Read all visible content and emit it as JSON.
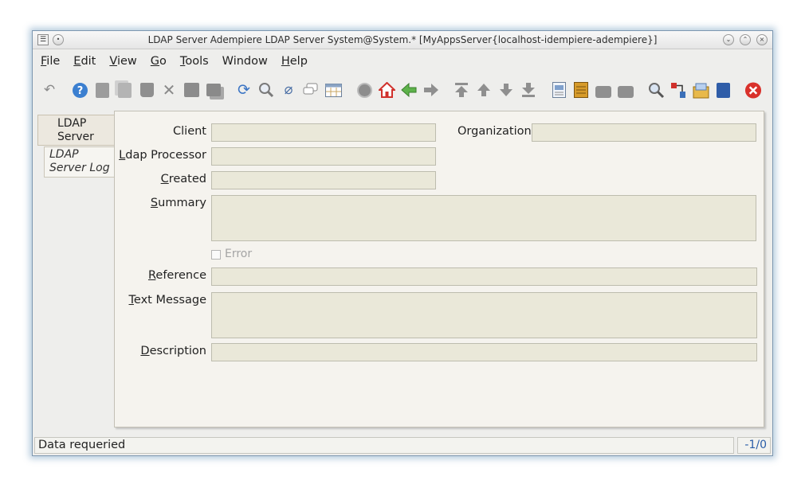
{
  "window": {
    "title": "LDAP Server  Adempiere LDAP Server  System@System.* [MyAppsServer{localhost-idempiere-adempiere}]"
  },
  "menu": {
    "file": "File",
    "edit": "Edit",
    "view": "View",
    "go": "Go",
    "tools": "Tools",
    "window": "Window",
    "help": "Help"
  },
  "toolbar": {
    "icons": [
      "undo-icon",
      "help-icon",
      "new-icon",
      "copy-icon",
      "delete-icon",
      "delete-selection-icon",
      "save-icon",
      "save-new-icon",
      "refresh-icon",
      "find-icon",
      "attachment-icon",
      "chat-icon",
      "grid-toggle-icon",
      "history-icon",
      "home-icon",
      "parent-icon",
      "detail-icon",
      "first-record-icon",
      "previous-record-icon",
      "next-record-icon",
      "last-record-icon",
      "report-icon",
      "archive-icon",
      "print-preview-icon",
      "print-icon",
      "zoom-across-icon",
      "workflow-icon",
      "product-info-icon",
      "end-icon",
      "close-window-icon"
    ]
  },
  "tabs": [
    {
      "label_line1": "LDAP",
      "label_line2": "Server"
    },
    {
      "label_line1": "LDAP",
      "label_line2": "Server Log"
    }
  ],
  "form": {
    "client_label": "Client",
    "client_value": "",
    "organization_label": "Organization",
    "organization_value": "",
    "ldap_processor_label_pre": "",
    "ldap_processor_label_u": "L",
    "ldap_processor_label_post": "dap Processor",
    "ldap_processor_value": "",
    "created_label_u": "C",
    "created_label_post": "reated",
    "created_value": "",
    "summary_label_u": "S",
    "summary_label_post": "ummary",
    "summary_value": "",
    "error_label": "Error",
    "error_checked": false,
    "reference_label_u": "R",
    "reference_label_post": "eference",
    "reference_value": "",
    "text_message_label_u": "T",
    "text_message_label_post": "ext Message",
    "text_message_value": "",
    "description_label_u": "D",
    "description_label_post": "escription",
    "description_value": ""
  },
  "status": {
    "message": "Data requeried",
    "record_count": "-1/0"
  },
  "colors": {
    "field_bg": "#eae8d9",
    "panel_bg": "#f5f3ee",
    "close_red": "#d9312b",
    "status_count_blue": "#2a5da8"
  }
}
